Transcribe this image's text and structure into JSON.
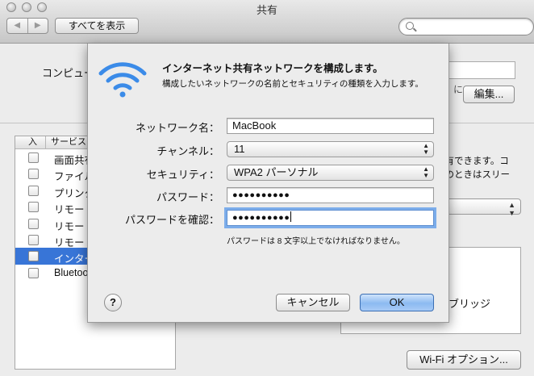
{
  "window": {
    "title": "共有",
    "nav_back": "◀",
    "nav_forward": "▶",
    "show_all_label": "すべてを表示",
    "search_placeholder": ""
  },
  "background": {
    "computer_name_label": "コンピュー",
    "computer_name_suffix": "に",
    "edit_button": "編集...",
    "table_headers": [
      "入",
      "サービス"
    ],
    "services": [
      {
        "label": "画面共有",
        "checked": false,
        "selected": false
      },
      {
        "label": "ファイル",
        "checked": false,
        "selected": false
      },
      {
        "label": "プリンタ",
        "checked": false,
        "selected": false
      },
      {
        "label": "リモート",
        "checked": false,
        "selected": false
      },
      {
        "label": "リモート",
        "checked": false,
        "selected": false
      },
      {
        "label": "リモート",
        "checked": false,
        "selected": false
      },
      {
        "label": "インター",
        "checked": false,
        "selected": true
      },
      {
        "label": "Bluetoo",
        "checked": false,
        "selected": false
      }
    ],
    "right_text_1": "共有できます。コ",
    "right_text_2": "入のときはスリー",
    "bridge_label": "ブリッジ",
    "wifi_options_button": "Wi-Fi オプション..."
  },
  "dialog": {
    "title": "インターネット共有ネットワークを構成します。",
    "description": "構成したいネットワークの名前とセキュリティの種類を入力します。",
    "network_name_label": "ネットワーク名：",
    "network_name_value": "MacBook",
    "channel_label": "チャンネル：",
    "channel_value": "11",
    "security_label": "セキュリティ：",
    "security_value": "WPA2 パーソナル",
    "password_label": "パスワード：",
    "password_value": "●●●●●●●●●●",
    "confirm_label": "パスワードを確認：",
    "confirm_value": "●●●●●●●●●●",
    "hint": "パスワードは 8 文字以上でなければなりません。",
    "help_label": "?",
    "cancel_button": "キャンセル",
    "ok_button": "OK"
  },
  "colors": {
    "selection": "#3875d7",
    "wifi_icon": "#3b8be8",
    "focus_ring": "#7cadea"
  }
}
